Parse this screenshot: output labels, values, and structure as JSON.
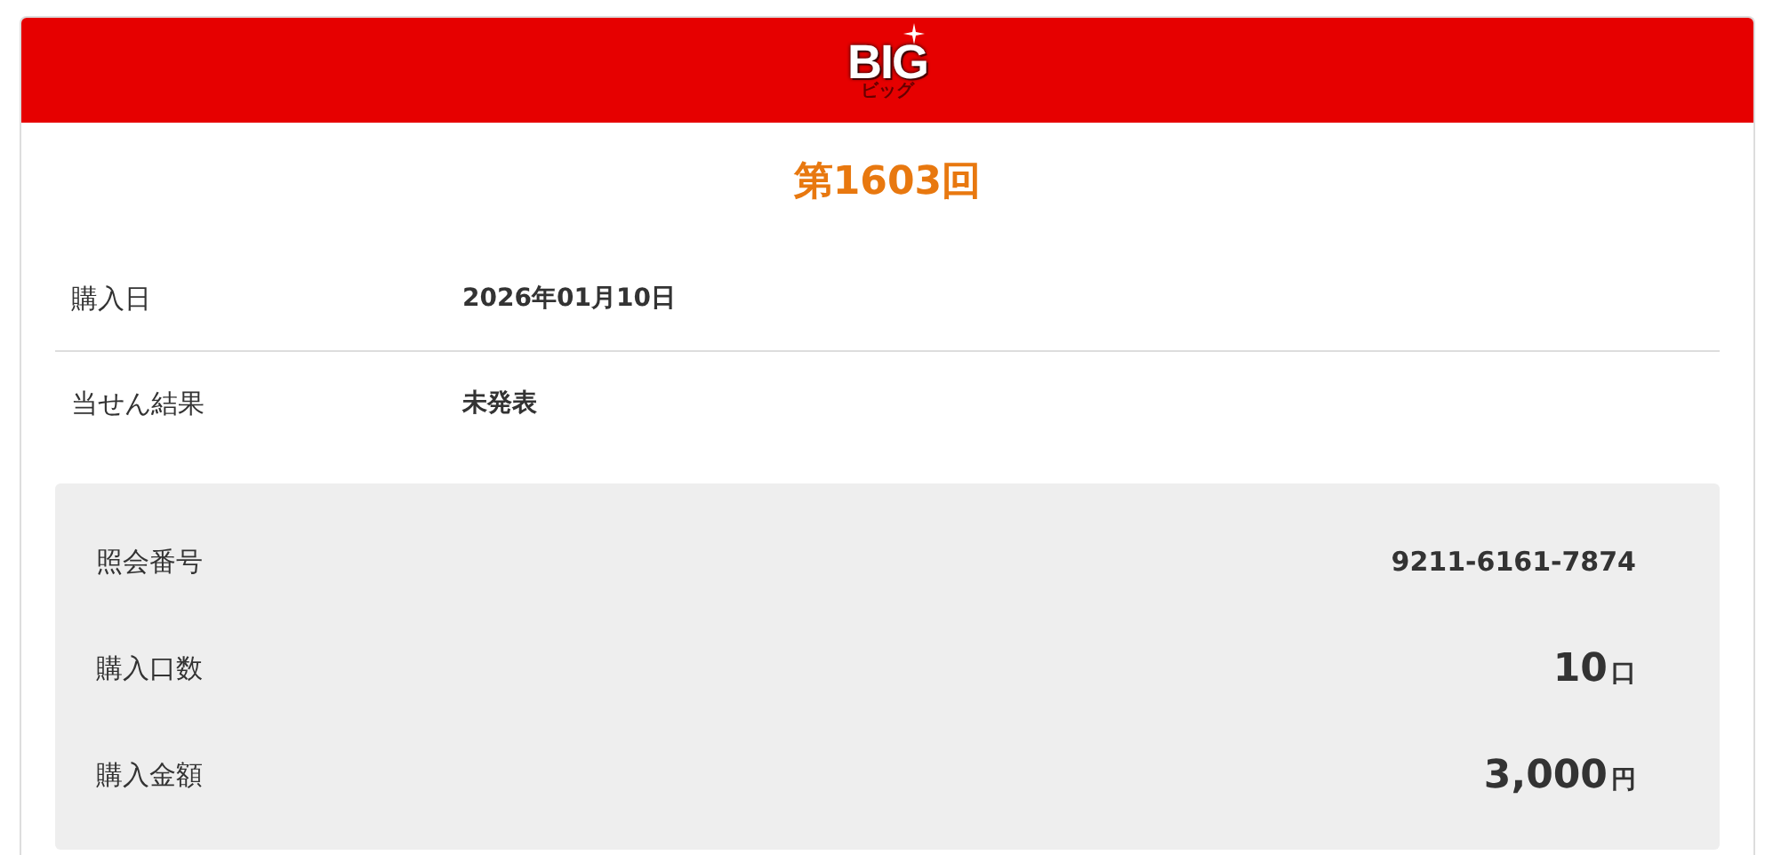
{
  "header": {
    "logo": "BIG",
    "logo_sub": "ビッグ"
  },
  "title": "第1603回",
  "rows": [
    {
      "label": "購入日",
      "value": "2026年01月10日"
    },
    {
      "label": "当せん結果",
      "value": "未発表"
    }
  ],
  "details": [
    {
      "label": "照会番号",
      "value": "9211-6161-7874",
      "kind": "plain"
    },
    {
      "label": "購入口数",
      "value": "10",
      "unit": "口",
      "kind": "amount"
    },
    {
      "label": "購入金額",
      "value": "3,000",
      "unit": "円",
      "kind": "amount"
    }
  ]
}
